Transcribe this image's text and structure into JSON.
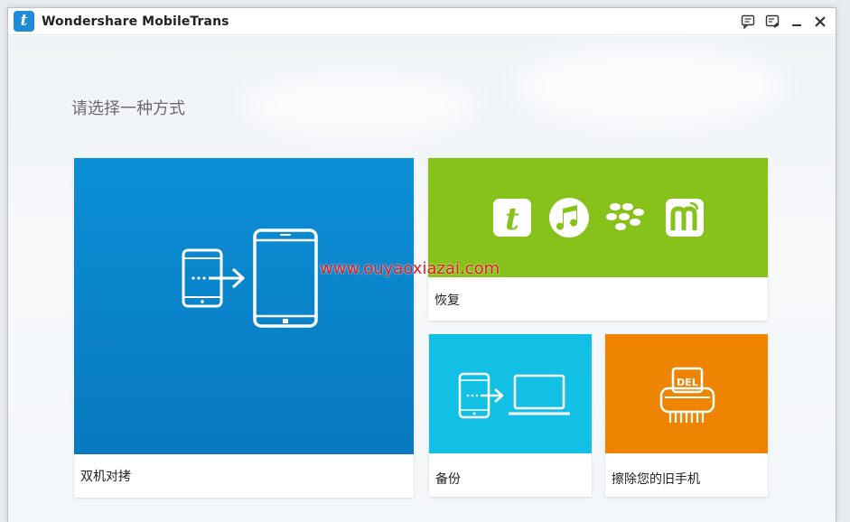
{
  "window": {
    "title": "Wondershare MobileTrans",
    "logo_letter": "t"
  },
  "titlebar_icons": [
    "feedback-icon",
    "register-icon",
    "minimize-icon",
    "close-icon"
  ],
  "page": {
    "heading": "请选择一种方式"
  },
  "tiles": {
    "transfer": {
      "label": "双机对拷",
      "color": "#0a86cc"
    },
    "restore": {
      "label": "恢复",
      "color": "#86c21a"
    },
    "backup": {
      "label": "备份",
      "color": "#12c0e6"
    },
    "erase": {
      "label": "擦除您的旧手机",
      "color": "#ef8400",
      "badge": "DEL"
    }
  },
  "restore_sources": [
    "mobiletrans-icon",
    "itunes-icon",
    "blackberry-icon",
    "mobilego-icon"
  ],
  "watermark": "www.ouyaoxiazai.com"
}
